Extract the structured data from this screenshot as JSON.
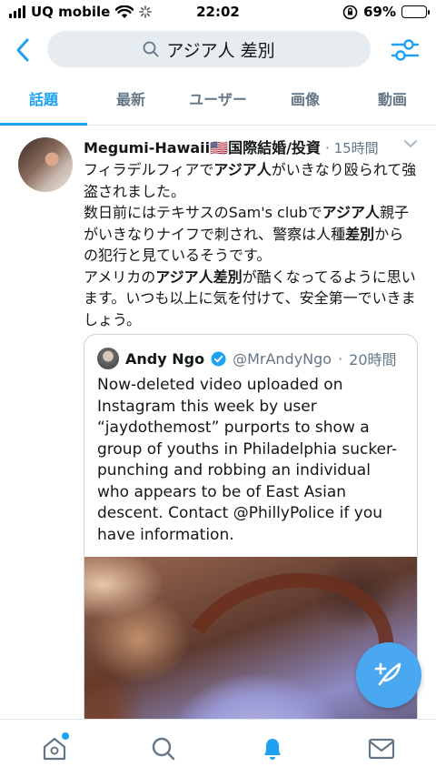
{
  "status_bar": {
    "carrier": "UQ mobile",
    "time": "22:02",
    "battery": "69%",
    "battery_level": 0.69
  },
  "search": {
    "query": "アジア人 差別"
  },
  "tabs": [
    {
      "label": "話題",
      "active": true
    },
    {
      "label": "最新",
      "active": false
    },
    {
      "label": "ユーザー",
      "active": false
    },
    {
      "label": "画像",
      "active": false
    },
    {
      "label": "動画",
      "active": false
    }
  ],
  "tweet": {
    "name": "Megumi-Hawaii",
    "flag": "🇺🇸",
    "name_suffix": "国際結婚/投資",
    "time": "15時間",
    "text_line1_a": "フィラデルフィアで",
    "text_line1_b": "アジア人",
    "text_line1_c": "がいきなり殴られて強盗されました。",
    "text_line2_a": "数日前にはテキサスのSam's clubで",
    "text_line2_b": "アジア人",
    "text_line2_c": "親子がいきなりナイフで刺され、警察は人種",
    "text_line2_d": "差別",
    "text_line2_e": "からの犯行と見ているそうです。",
    "text_line3_a": "アメリカの",
    "text_line3_b": "アジア人差別",
    "text_line3_c": "が酷くなってるように思います。いつも以上に気を付けて、安全第一でいきましょう。"
  },
  "quote": {
    "name": "Andy Ngo",
    "handle": "@MrAndyNgo",
    "separator": "·",
    "time": "20時間",
    "text": "Now-deleted video uploaded on Instagram this week by user “jaydothemost” purports to show a group of youths in Philadelphia sucker-punching and robbing an individual who appears to be of East Asian descent. Contact @PhillyPolice  if you have information."
  },
  "colors": {
    "accent": "#1da1f2",
    "fab": "#4aa8f0",
    "muted": "#657786"
  },
  "icons": {
    "back": "chevron-left-icon",
    "filter": "sliders-icon",
    "home": "home-icon",
    "search": "search-icon",
    "notifications": "bell-icon",
    "messages": "mail-icon",
    "compose": "compose-feather-icon"
  }
}
